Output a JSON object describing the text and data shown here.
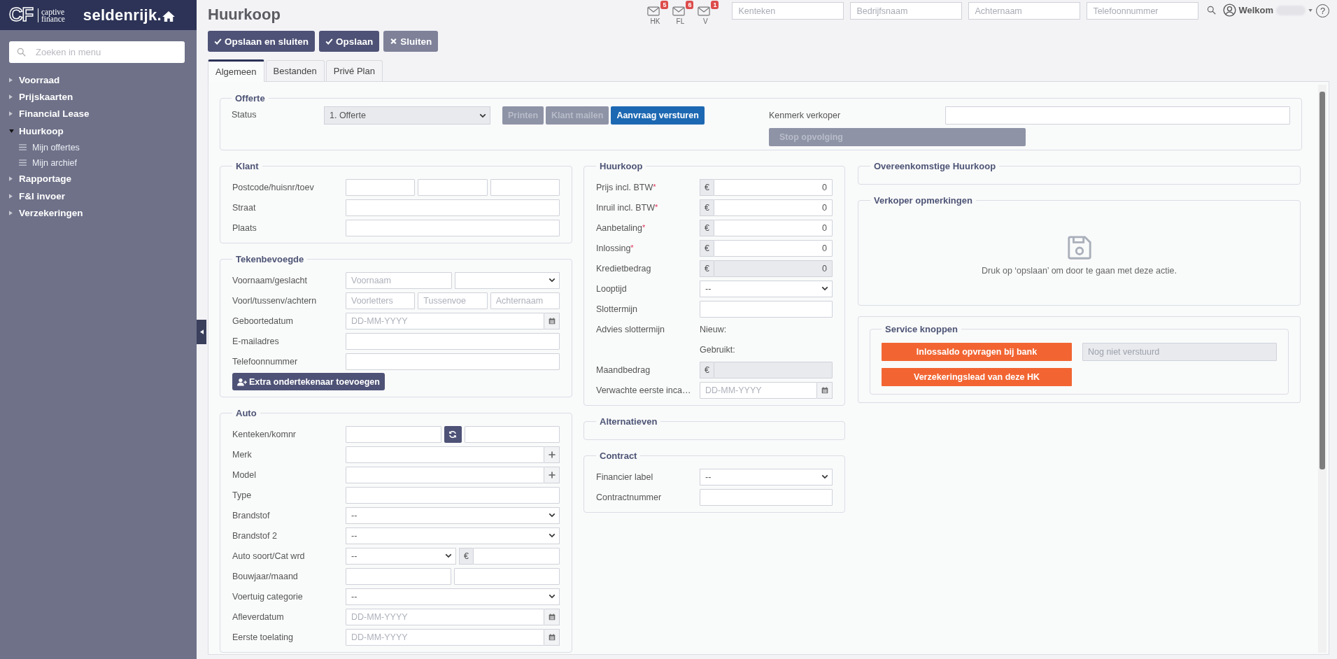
{
  "sidebar": {
    "logo": {
      "mark": "CF",
      "line_1": "captive",
      "line_2": "finance",
      "brand": "seldenrijk."
    },
    "search": {
      "placeholder": "Zoeken in menu"
    },
    "items": [
      {
        "label": "Voorraad",
        "expanded": false
      },
      {
        "label": "Prijskaarten",
        "expanded": false
      },
      {
        "label": "Financial Lease",
        "expanded": false
      },
      {
        "label": "Huurkoop",
        "expanded": true,
        "children": [
          {
            "label": "Mijn offertes"
          },
          {
            "label": "Mijn archief"
          }
        ]
      },
      {
        "label": "Rapportage",
        "expanded": false
      },
      {
        "label": "F&I invoer",
        "expanded": false
      },
      {
        "label": "Verzekeringen",
        "expanded": false
      }
    ]
  },
  "header": {
    "title": "Huurkoop",
    "inboxes": [
      {
        "label": "HK",
        "count": "5"
      },
      {
        "label": "FL",
        "count": "6"
      },
      {
        "label": "V",
        "count": "1"
      }
    ],
    "search_fields": [
      {
        "placeholder": "Kenteken"
      },
      {
        "placeholder": "Bedrijfsnaam"
      },
      {
        "placeholder": "Achternaam"
      },
      {
        "placeholder": "Telefoonnummer"
      }
    ],
    "user": {
      "greeting": "Welkom",
      "help": "?"
    }
  },
  "toolbar": [
    {
      "label": "Opslaan en sluiten",
      "kind": "primary"
    },
    {
      "label": "Opslaan",
      "kind": "primary"
    },
    {
      "label": "Sluiten",
      "kind": "secondary"
    }
  ],
  "tabs": [
    {
      "label": "Algemeen",
      "selected": true
    },
    {
      "label": "Bestanden",
      "selected": false
    },
    {
      "label": "Privé Plan",
      "selected": false
    }
  ],
  "offerte": {
    "title": "Offerte",
    "status_label": "Status",
    "status": "1. Offerte",
    "actions": [
      {
        "label": "Printen",
        "disabled": true
      },
      {
        "label": "Klant mailen",
        "disabled": true
      },
      {
        "label": "Aanvraag versturen",
        "disabled": false
      }
    ],
    "reference_label": "Kenmerk verkoper",
    "stop_button": {
      "label": "Stop opvolging",
      "disabled": true
    }
  },
  "columns": [
    [
      {
        "kind": "form",
        "title": "Klant",
        "rows": [
          {
            "label": "Postcode/huisnr/toev",
            "controls": [
              {
                "kind": "text"
              },
              {
                "kind": "text"
              },
              {
                "kind": "text"
              }
            ]
          },
          {
            "label": "Straat",
            "controls": [
              {
                "kind": "text"
              }
            ]
          },
          {
            "label": "Plaats",
            "controls": [
              {
                "kind": "text"
              }
            ]
          }
        ]
      },
      {
        "kind": "form",
        "title": "Tekenbevoegde",
        "rows": [
          {
            "label": "Voornaam/geslacht",
            "controls": [
              {
                "kind": "text",
                "placeholder": "Voornaam"
              },
              {
                "kind": "select"
              }
            ]
          },
          {
            "label": "Voorl/tussenv/achtern",
            "controls": [
              {
                "kind": "text",
                "placeholder": "Voorletters"
              },
              {
                "kind": "text",
                "placeholder": "Tussenvoe"
              },
              {
                "kind": "text",
                "placeholder": "Achternaam"
              }
            ]
          },
          {
            "label": "Geboortedatum",
            "controls": [
              {
                "kind": "date",
                "placeholder": "DD-MM-YYYY"
              }
            ]
          },
          {
            "label": "E-mailadres",
            "controls": [
              {
                "kind": "text"
              }
            ]
          },
          {
            "label": "Telefoonnummer",
            "controls": [
              {
                "kind": "text"
              }
            ]
          }
        ],
        "button": {
          "label": "Extra ondertekenaar toevoegen"
        }
      },
      {
        "kind": "form",
        "title": "Auto",
        "rows": [
          {
            "label": "Kenteken/komnr",
            "controls": [
              {
                "kind": "text"
              },
              {
                "kind": "refresh"
              },
              {
                "kind": "text"
              }
            ]
          },
          {
            "label": "Merk",
            "controls": [
              {
                "kind": "plus"
              }
            ]
          },
          {
            "label": "Model",
            "controls": [
              {
                "kind": "plus"
              }
            ]
          },
          {
            "label": "Type",
            "controls": [
              {
                "kind": "text"
              }
            ]
          },
          {
            "label": "Brandstof",
            "controls": [
              {
                "kind": "select",
                "value": "--"
              }
            ]
          },
          {
            "label": "Brandstof 2",
            "controls": [
              {
                "kind": "select",
                "value": "--"
              }
            ]
          },
          {
            "label": "Auto soort/Cat wrd",
            "controls": [
              {
                "kind": "select",
                "value": "--"
              },
              {
                "kind": "money",
                "currency": "€",
                "disabled": false
              }
            ]
          },
          {
            "label": "Bouwjaar/maand",
            "controls": [
              {
                "kind": "text"
              },
              {
                "kind": "text"
              }
            ]
          },
          {
            "label": "Voertuig categorie",
            "controls": [
              {
                "kind": "select",
                "value": "--"
              }
            ]
          },
          {
            "label": "Afleverdatum",
            "controls": [
              {
                "kind": "date",
                "placeholder": "DD-MM-YYYY"
              }
            ]
          },
          {
            "label": "Eerste toelating",
            "controls": [
              {
                "kind": "date",
                "placeholder": "DD-MM-YYYY"
              }
            ]
          }
        ]
      }
    ],
    [
      {
        "kind": "form",
        "title": "Huurkoop",
        "rows": [
          {
            "label": "Prijs incl. BTW",
            "required_mark": "*",
            "controls": [
              {
                "kind": "money",
                "currency": "€",
                "value": "0",
                "disabled": false
              }
            ]
          },
          {
            "label": "Inruil incl. BTW",
            "required_mark": "*",
            "controls": [
              {
                "kind": "money",
                "currency": "€",
                "value": "0",
                "disabled": false
              }
            ]
          },
          {
            "label": "Aanbetaling",
            "required_mark": "*",
            "controls": [
              {
                "kind": "money",
                "currency": "€",
                "value": "0",
                "disabled": false
              }
            ]
          },
          {
            "label": "Inlossing",
            "required_mark": "*",
            "controls": [
              {
                "kind": "money",
                "currency": "€",
                "value": "0",
                "disabled": false
              }
            ]
          },
          {
            "label": "Kredietbedrag",
            "controls": [
              {
                "kind": "money",
                "currency": "€",
                "value": "0",
                "disabled": true
              }
            ]
          },
          {
            "label": "Looptijd",
            "controls": [
              {
                "kind": "select",
                "value": "--"
              }
            ]
          },
          {
            "label": "Slottermijn",
            "controls": [
              {
                "kind": "text"
              }
            ]
          },
          {
            "label": "Advies slottermijn",
            "controls": [
              {
                "kind": "note",
                "text": "Nieuw:"
              }
            ]
          },
          {
            "controls": [
              {
                "kind": "note",
                "text": "Gebruikt:"
              }
            ]
          },
          {
            "label": "Maandbedrag",
            "controls": [
              {
                "kind": "money",
                "currency": "€",
                "disabled": true
              }
            ]
          },
          {
            "label": "Verwachte eerste inca…",
            "controls": [
              {
                "kind": "date",
                "placeholder": "DD-MM-YYYY"
              }
            ]
          }
        ]
      },
      {
        "kind": "form",
        "title": "Alternatieven"
      },
      {
        "kind": "form",
        "title": "Contract",
        "rows": [
          {
            "label": "Financier label",
            "controls": [
              {
                "kind": "select",
                "value": "--"
              }
            ]
          },
          {
            "label": "Contractnummer",
            "controls": [
              {
                "kind": "text"
              }
            ]
          }
        ]
      }
    ],
    [
      {
        "kind": "form",
        "title": "Overeenkomstige Huurkoop"
      },
      {
        "kind": "message",
        "title": "Verkoper opmerkingen",
        "message": "Druk op ‘opslaan’ om door te gaan met deze actie."
      },
      {
        "kind": "service",
        "title": "Service knoppen",
        "buttons": [
          {
            "label": "Inlossaldo opvragen bij bank"
          },
          {
            "label": "Verzekeringslead van deze HK"
          }
        ],
        "status_field": {
          "placeholder": "Nog niet verstuurd",
          "disabled": true
        }
      }
    ]
  ]
}
